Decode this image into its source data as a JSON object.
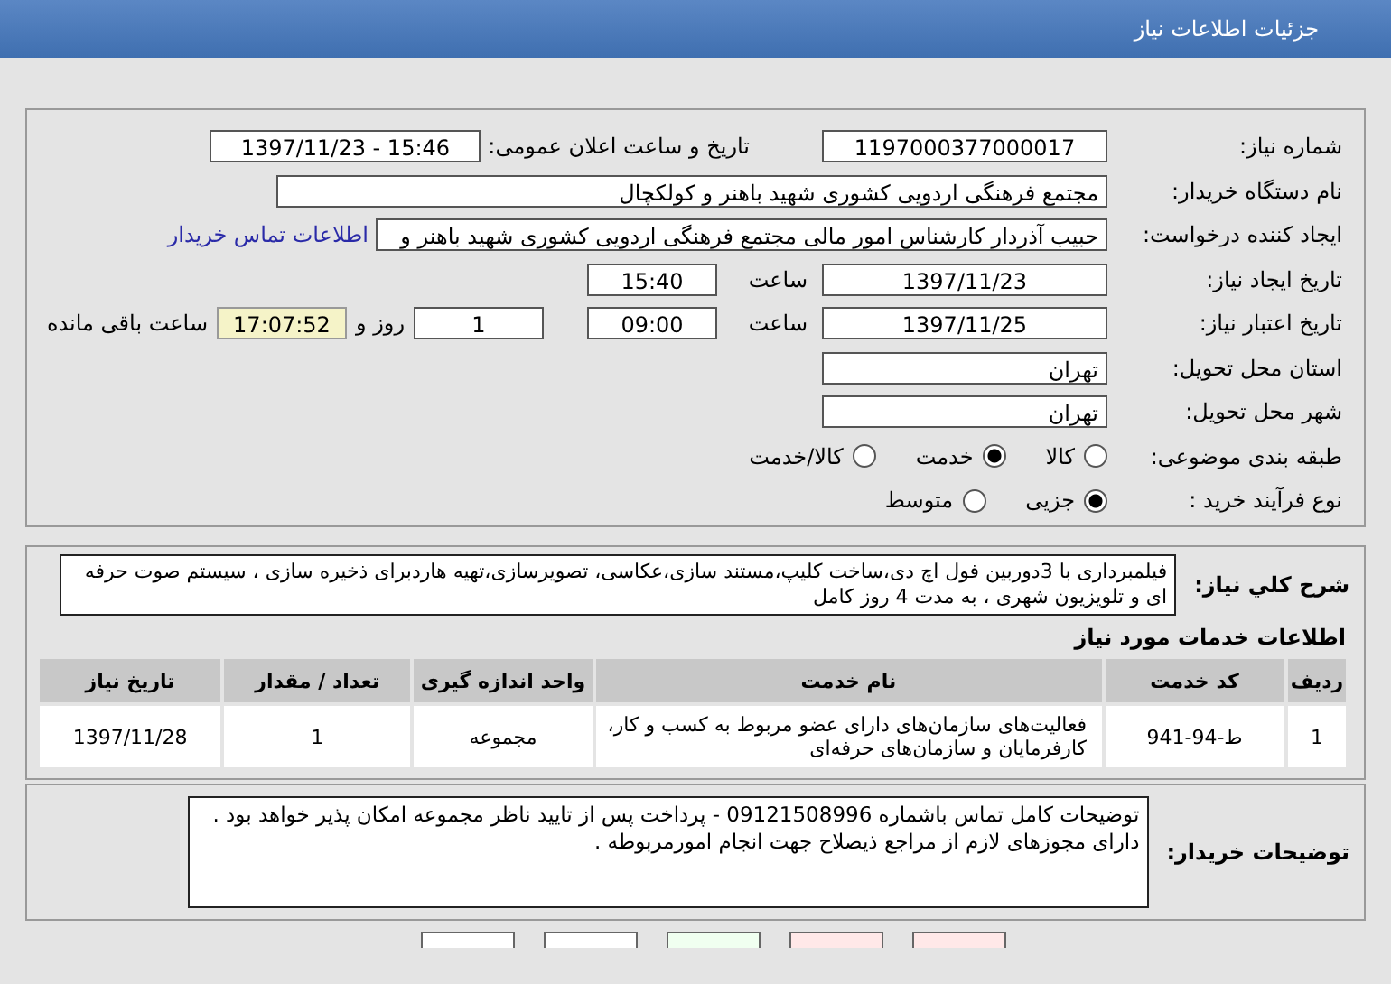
{
  "window": {
    "title": "جزئیات اطلاعات نیاز"
  },
  "details": {
    "need_number": {
      "label": "شماره نیاز:",
      "value": "1197000377000017"
    },
    "announce": {
      "label": "تاریخ و ساعت اعلان عمومی:",
      "value": "1397/11/23 - 15:46"
    },
    "buyer_org": {
      "label": "نام دستگاه خریدار:",
      "value": "مجتمع فرهنگی اردویی کشوری شهید باهنر و کولکچال"
    },
    "requester": {
      "label": "ایجاد کننده درخواست:",
      "value": "حبیب آذردار کارشناس امور مالی  مجتمع فرهنگی اردویی کشوری شهید باهنر و",
      "link": "اطلاعات تماس خریدار"
    },
    "created": {
      "label": "تاریخ ایجاد نیاز:",
      "date": "1397/11/23",
      "time_label": "ساعت",
      "time": "15:40"
    },
    "valid": {
      "label": "تاریخ اعتبار نیاز:",
      "date": "1397/11/25",
      "time_label": "ساعت",
      "time": "09:00",
      "days": "1",
      "days_label": "روز و",
      "remaining": "17:07:52",
      "remaining_label": "ساعت باقی مانده"
    },
    "province": {
      "label": "استان محل تحویل:",
      "value": "تهران"
    },
    "city": {
      "label": "شهر محل تحویل:",
      "value": "تهران"
    },
    "category": {
      "label": "طبقه بندی موضوعی:",
      "options": [
        {
          "label": "کالا",
          "selected": false
        },
        {
          "label": "خدمت",
          "selected": true
        },
        {
          "label": "کالا/خدمت",
          "selected": false
        }
      ]
    },
    "process": {
      "label": "نوع فرآیند خرید :",
      "options": [
        {
          "label": "جزیی",
          "selected": true
        },
        {
          "label": "متوسط",
          "selected": false
        }
      ]
    }
  },
  "summary": {
    "label": "شرح کلي نياز:",
    "value": "فیلمبرداری با 3دوربین فول اچ دی،ساخت کلیپ،مستند سازی،عکاسی، تصویرسازی،تهیه هاردبرای ذخیره سازی ، سیستم صوت حرفه ای و تلویزیون شهری ، به مدت 4 روز کامل"
  },
  "services": {
    "title": "اطلاعات خدمات مورد نیاز",
    "columns": [
      "ردیف",
      "کد خدمت",
      "نام خدمت",
      "واحد اندازه گیری",
      "تعداد / مقدار",
      "تاریخ نیاز"
    ],
    "rows": [
      [
        "1",
        "ط-94-941",
        "فعالیت‌های سازمان‌های دارای عضو مربوط به کسب و کار، کارفرمایان و سازمان‌های حرفه‌ای",
        "مجموعه",
        "1",
        "1397/11/28"
      ]
    ]
  },
  "buyer_notes": {
    "label": "توضیحات خریدار:",
    "value": "توضیحات کامل تماس باشماره 09121508996 - پرداخت پس از تایید ناظر مجموعه امکان پذیر خواهد بود . دارای مجوزهای لازم از مراجع ذیصلاح جهت انجام امورمربوطه ."
  },
  "buttons": [
    {
      "color": "#ffffff"
    },
    {
      "color": "#ffffff"
    },
    {
      "color": "#f0fff0"
    },
    {
      "color": "#ffe8e8"
    },
    {
      "color": "#ffe8e8"
    }
  ]
}
